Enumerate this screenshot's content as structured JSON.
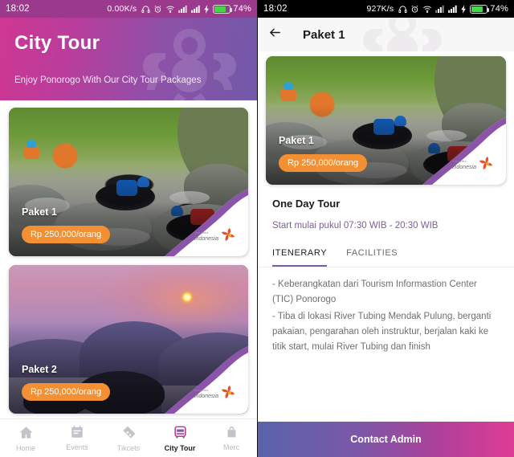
{
  "left": {
    "statusbar": {
      "time": "18:02",
      "speed": "0.00K/s",
      "battery": "74%",
      "icons": [
        "headphone-icon",
        "alarm-icon",
        "wifi-icon",
        "signal-icon",
        "signal-icon",
        "charging-icon",
        "battery-icon"
      ]
    },
    "header": {
      "title": "City Tour",
      "subtitle": "Enjoy Ponorogo With Our City Tour Packages"
    },
    "cards": [
      {
        "name": "Paket 1",
        "price": "Rp 250,000/orang",
        "logo": "wonderful-indonesia-logo"
      },
      {
        "name": "Paket 2",
        "price": "Rp 250,000/orang",
        "logo": "wonderful-indonesia-logo"
      }
    ],
    "nav": [
      {
        "label": "Home",
        "icon": "home-icon",
        "active": false
      },
      {
        "label": "Events",
        "icon": "calendar-icon",
        "active": false
      },
      {
        "label": "Tikcets",
        "icon": "ticket-icon",
        "active": false
      },
      {
        "label": "City Tour",
        "icon": "bus-icon",
        "active": true
      },
      {
        "label": "Merc",
        "icon": "bag-icon",
        "active": false
      }
    ]
  },
  "right": {
    "statusbar": {
      "time": "18:02",
      "speed": "927K/s",
      "battery": "74%"
    },
    "header": {
      "back": "back-arrow",
      "title": "Paket 1"
    },
    "card": {
      "name": "Paket 1",
      "price": "Rp 250,000/orang",
      "logo": "wonderful-indonesia-logo"
    },
    "detail": {
      "title": "One Day Tour",
      "schedule": "Start mulai pukul 07:30 WIB - 20:30 WIB"
    },
    "tabs": [
      {
        "label": "ITENERARY",
        "active": true
      },
      {
        "label": "FACILITIES",
        "active": false
      }
    ],
    "itinerary": [
      "- Keberangkatan dari Tourism Informastion Center (TIC) Ponorogo",
      "- Tiba di lokasi River Tubing Mendak Pulung, berganti pakaian, pengarahan oleh instruktur, berjalan kaki ke titik start, mulai River Tubing dan finish"
    ],
    "contact_label": "Contact Admin"
  },
  "colors": {
    "accent_purple": "#7b5aa6",
    "price_orange": "#f29033",
    "pink": "#cf3792",
    "magenta": "#e03c93",
    "battery_green": "#4cd34c"
  }
}
